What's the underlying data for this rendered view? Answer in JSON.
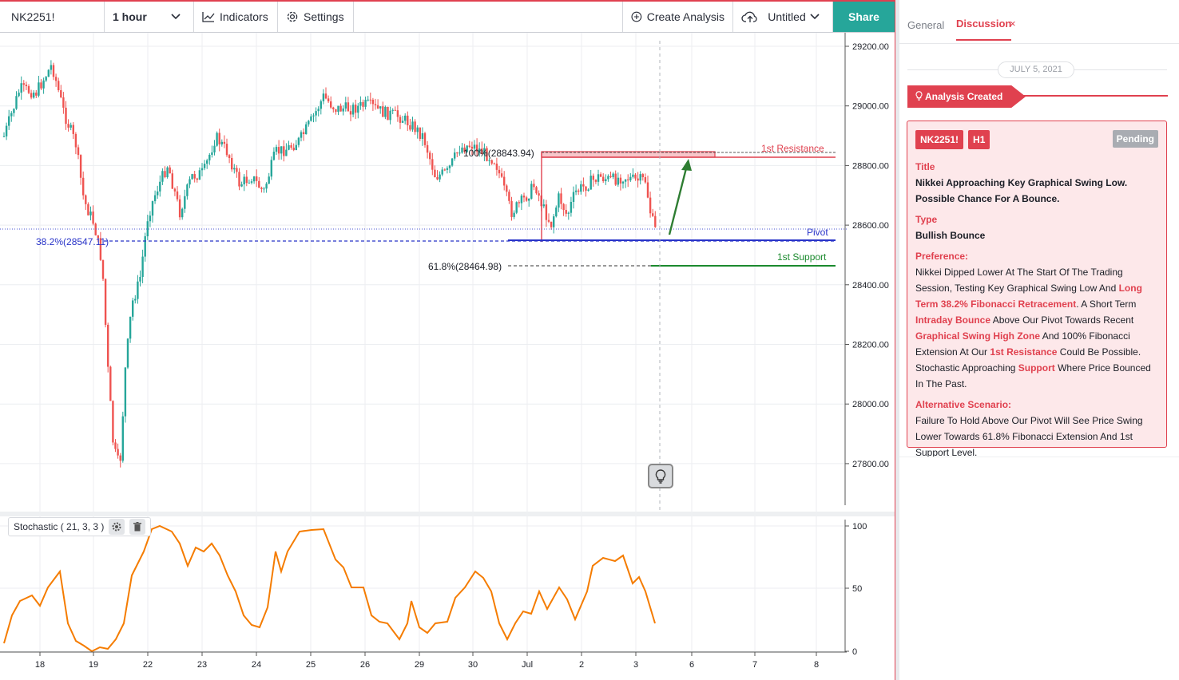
{
  "toolbar": {
    "symbol": "NK2251!",
    "interval": "1 hour",
    "indicators_label": "Indicators",
    "settings_label": "Settings",
    "create_analysis_label": "Create Analysis",
    "layout_name": "Untitled",
    "share_label": "Share"
  },
  "chart": {
    "price_axis": [
      "29200.00",
      "29000.00",
      "28800.00",
      "28600.00",
      "28400.00",
      "28200.00",
      "28000.00",
      "27800.00"
    ],
    "stoch_axis": [
      "100",
      "50",
      "0"
    ],
    "time_axis": [
      "18",
      "19",
      "22",
      "23",
      "24",
      "25",
      "26",
      "29",
      "30",
      "Jul",
      "2",
      "3",
      "6",
      "7",
      "8"
    ],
    "annotations": {
      "fib_100": "100%(28843.94)",
      "fib_382": "38.2%(28547.11)",
      "fib_618": "61.8%(28464.98)",
      "resistance": "1st Resistance",
      "pivot": "Pivot",
      "support": "1st Support"
    },
    "levels": {
      "resistance": 28830,
      "pivot": 28547.11,
      "support": 28464.98,
      "dotted_pivot": 28590
    },
    "colors": {
      "up": "#26a69a",
      "down": "#ef5350",
      "resistance": "#e0414f",
      "pivot": "#2833c8",
      "support": "#1b8a2e",
      "stochastic": "#f57c00",
      "arrow": "#2e7d32"
    }
  },
  "indicator": {
    "name": "Stochastic ( 21, 3, 3 )",
    "settings_icon": "gear-icon",
    "delete_icon": "trash-icon"
  },
  "panel": {
    "tabs": {
      "general": "General",
      "discussion": "Discussion",
      "close": "×"
    },
    "date": "JULY 5, 2021",
    "analysis_created": "Analysis Created",
    "card": {
      "symbol_tag": "NK2251!",
      "timeframe_tag": "H1",
      "status": "Pending",
      "title_label": "Title",
      "title": "Nikkei Approaching Key Graphical Swing Low. Possible Chance For A Bounce.",
      "type_label": "Type",
      "type": "Bullish Bounce",
      "preference_label": "Preference:",
      "preference": {
        "p1": "Nikkei Dipped Lower At The Start Of The Trading Session, Testing Key Graphical Swing Low And ",
        "h1": "Long Term 38.2% Fibonacci Retracement",
        "p2": ". A Short Term ",
        "h2": "Intraday Bounce",
        "p3": " Above Our Pivot Towards Recent ",
        "h3": "Graphical Swing High Zone",
        "p4": " And 100% Fibonacci Extension At Our ",
        "h4": "1st Resistance",
        "p5": " Could Be Possible. Stochastic Approaching ",
        "h5": "Support",
        "p6": " Where Price Bounced In The Past."
      },
      "alternative_label": "Alternative Scenario:",
      "alternative": "Failure To Hold Above Our Pivot Will See Price Swing Lower Towards 61.8% Fibonacci Extension And 1st Support Level."
    }
  }
}
